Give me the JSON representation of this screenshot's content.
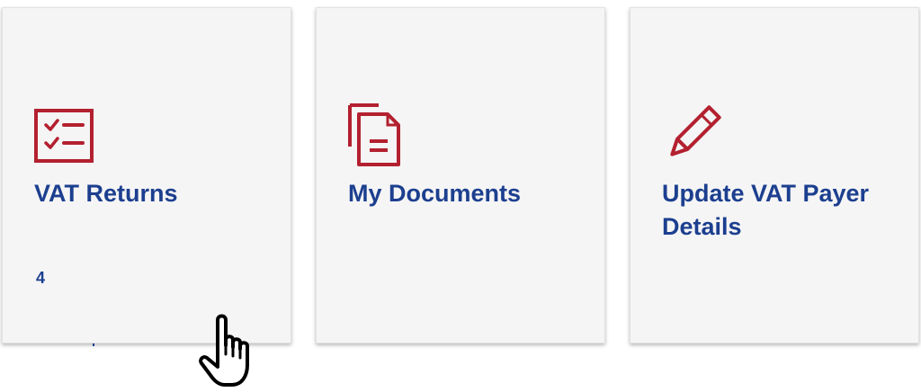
{
  "tiles": [
    {
      "title": "VAT Returns",
      "count": "4",
      "icon": "checklist-icon"
    },
    {
      "title": "My Documents",
      "icon": "documents-icon"
    },
    {
      "title": "Update VAT Payer Details",
      "icon": "pencil-icon"
    }
  ],
  "colors": {
    "icon_red": "#b3202f",
    "title_blue": "#1c3f8f",
    "tile_bg": "#f5f5f5"
  },
  "cursor": {
    "icon": "hand-pointer-cursor-icon"
  }
}
